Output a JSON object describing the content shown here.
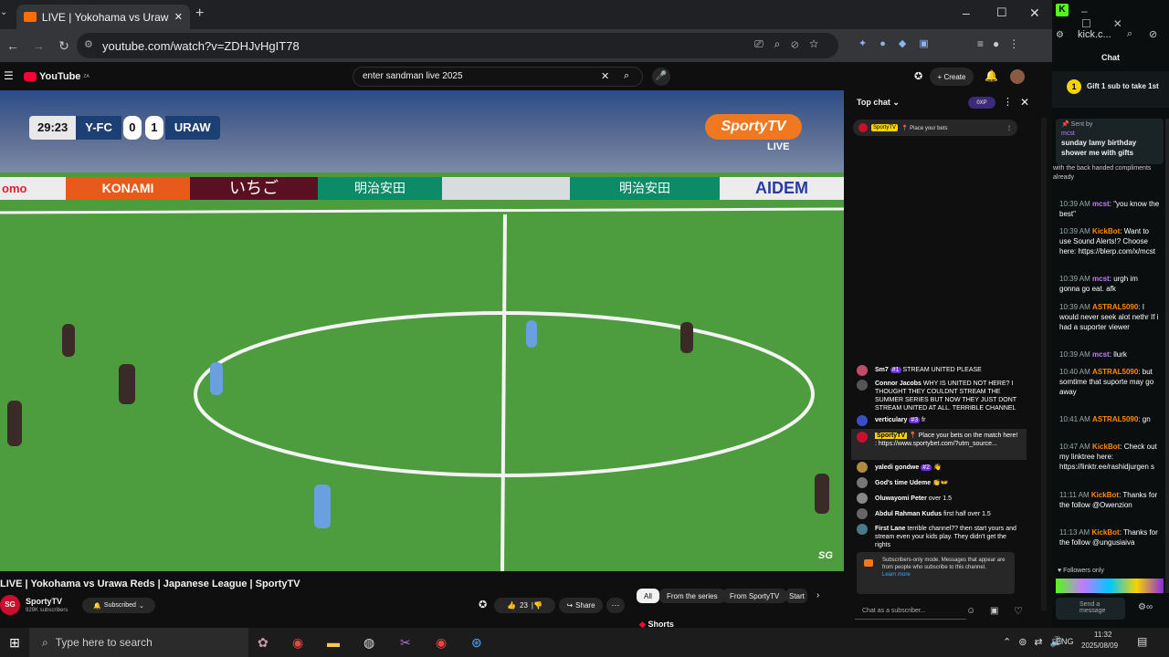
{
  "browser": {
    "tab_title": "LIVE | Yokohama vs Urawa R",
    "url": "youtube.com/watch?v=ZDHJvHgIT78",
    "window_controls": [
      "–",
      "☐",
      "✕"
    ]
  },
  "youtube": {
    "logo": "YouTube",
    "logo_region": "ZA",
    "search_value": "enter sandman live 2025",
    "create_label": "Create"
  },
  "scoreboard": {
    "clock": "29:23",
    "home": "Y-FC",
    "home_score": "0",
    "away_score": "1",
    "away": "URAW"
  },
  "broadcaster": {
    "logo": "SportyTV",
    "live": "LIVE",
    "watermark": "SG"
  },
  "ads": [
    "omo",
    "KONAMI",
    "いちご",
    "明治安田",
    "明治安田",
    "AIDEM"
  ],
  "video_info": {
    "title": "LIVE | Yokohama vs Urawa Reds | Japanese League | SportyTV",
    "channel": "SportyTV",
    "subscribers": "929K subscribers",
    "subscribe_label": "Subscribed",
    "likes": "23",
    "share_label": "Share",
    "shorts_label": "Shorts"
  },
  "chips": [
    "All",
    "From the series",
    "From SportyTV",
    "Start"
  ],
  "live_chat": {
    "header": "Top chat",
    "points": "0XP",
    "pinned_user": "SportyTV",
    "pinned_text": "📍 Place your bets",
    "messages": [
      {
        "user": "Sm7",
        "badge": "#1",
        "text": "STREAM UNITED PLEASE"
      },
      {
        "user": "Connor Jacobs",
        "badge": "",
        "text": "WHY IS UNITED NOT HERE? I THOUGHT THEY COULDNT STREAM THE SUMMER SERIES BUT NOW THEY JUST DONT STREAM UNITED AT ALL. TERRIBLE CHANNEL"
      },
      {
        "user": "verticulary",
        "badge": "#3",
        "text": "fr"
      },
      {
        "user": "SportyTV",
        "badge": "",
        "text": "📍 Place your bets on the match here! : https://www.sportybet.com/?utm_source..."
      },
      {
        "user": "yaledi gondwe",
        "badge": "#2",
        "text": "👋"
      },
      {
        "user": "God's time Udeme",
        "badge": "",
        "text": "👏👐"
      },
      {
        "user": "Oluwayomi Peter",
        "badge": "",
        "text": "over 1.5"
      },
      {
        "user": "Abdul Rahman Kudus",
        "badge": "",
        "text": "first half over 1.5"
      },
      {
        "user": "First Lane",
        "badge": "",
        "text": "terrible channel?? then start yours and stream even your kids play. They didn't get the rights"
      }
    ],
    "subscribers_notice": "Subscribers-only mode. Messages that appear are from people who subscribe to this channel.",
    "learn_more": "Learn more",
    "input_placeholder": "Chat as a subscriber..."
  },
  "kick": {
    "url": "kick.c...",
    "chat_title": "Chat",
    "gift_text": "Gift 1 sub to take 1st",
    "pinned_by": "Sent by",
    "pinned_user": "mcst",
    "pinned_text": "sunday lamy birthday shower me with gifts",
    "cut_text": "with the back handed compliments already",
    "messages": [
      {
        "time": "10:39 AM",
        "user": "mcst",
        "text": "\"you know the best\""
      },
      {
        "time": "10:39 AM",
        "user": "KickBot",
        "text": "Want to use Sound Alerts!? Choose here: https://blerp.com/x/mcst"
      },
      {
        "time": "10:39 AM",
        "user": "mcst",
        "text": "urgh im gonna go eat. afk"
      },
      {
        "time": "10:39 AM",
        "user": "ASTRAL5090",
        "text": "I would never seek alot nethr If i had a suporter viewer"
      },
      {
        "time": "10:39 AM",
        "user": "mcst",
        "text": "llurk"
      },
      {
        "time": "10:40 AM",
        "user": "ASTRAL5090",
        "text": "but somtime that suporte may go away"
      },
      {
        "time": "10:41 AM",
        "user": "ASTRAL5090",
        "text": "gn"
      },
      {
        "time": "10:47 AM",
        "user": "KickBot",
        "text": "Check out my linktree here: https://linktr.ee/rashidjurgen s"
      },
      {
        "time": "11:11 AM",
        "user": "KickBot",
        "text": "Thanks for the follow @Owenzion"
      },
      {
        "time": "11:13 AM",
        "user": "KickBot",
        "text": "Thanks for the follow @ungusiaiva"
      }
    ],
    "followers_only": "Followers only",
    "send_label": "Send a message"
  },
  "taskbar": {
    "search_placeholder": "Type here to search",
    "lang": "ENG",
    "time": "11:32",
    "date": "2025/08/09"
  }
}
